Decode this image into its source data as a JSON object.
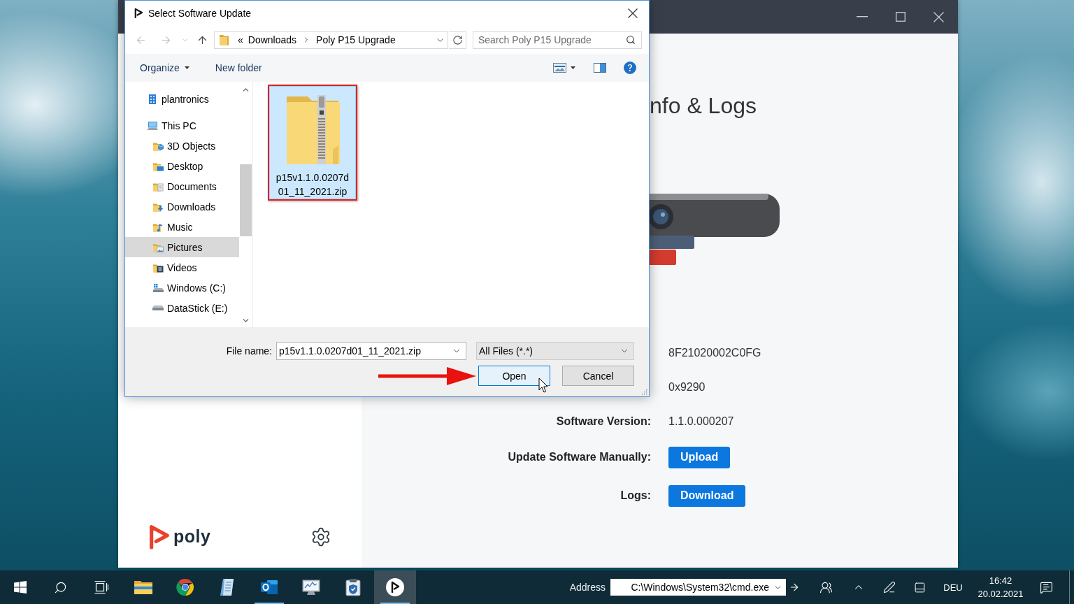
{
  "app_window": {
    "content": {
      "title": "nfo & Logs",
      "rows": [
        {
          "kind": "text",
          "value": "8F21020002C0FG"
        },
        {
          "kind": "text",
          "value": "0x9290"
        },
        {
          "kind": "text",
          "label": "Software Version:",
          "value": "1.1.0.000207"
        },
        {
          "kind": "button",
          "label": "Update Software Manually:",
          "value": "Upload"
        },
        {
          "kind": "button",
          "label": "Logs:",
          "value": "Download"
        }
      ]
    },
    "sidebar": {
      "logo_text": "poly"
    }
  },
  "dialog": {
    "title": "Select Software Update",
    "navigation": [
      {
        "kind": "back",
        "disabled": true
      },
      {
        "kind": "forward",
        "disabled": true
      },
      {
        "kind": "recent",
        "disabled": true
      },
      {
        "kind": "up",
        "disabled": false
      }
    ],
    "address": {
      "overflow": "«",
      "crumbs": [
        "Downloads",
        "Poly P15 Upgrade"
      ]
    },
    "search": {
      "placeholder": "Search Poly P15 Upgrade"
    },
    "toolbar": [
      {
        "kind": "menu",
        "label": "Organize"
      },
      {
        "kind": "button",
        "label": "New folder"
      }
    ],
    "nav_pane": [
      {
        "kind": "user",
        "label": "plantronics",
        "selected": false
      },
      {
        "kind": "computer",
        "label": "This PC",
        "selected": false,
        "children": [
          {
            "kind": "objects3d",
            "label": "3D Objects",
            "selected": false
          },
          {
            "kind": "desktop",
            "label": "Desktop",
            "selected": false
          },
          {
            "kind": "documents",
            "label": "Documents",
            "selected": false
          },
          {
            "kind": "downloads",
            "label": "Downloads",
            "selected": false
          },
          {
            "kind": "music",
            "label": "Music",
            "selected": false
          },
          {
            "kind": "pictures",
            "label": "Pictures",
            "selected": true
          },
          {
            "kind": "videos",
            "label": "Videos",
            "selected": false
          },
          {
            "kind": "system_drive",
            "label": "Windows (C:)",
            "selected": false
          },
          {
            "kind": "drive",
            "label": "DataStick (E:)",
            "selected": false
          }
        ]
      }
    ],
    "files": [
      {
        "kind": "zip",
        "name": "p15v1.1.0.0207d01_11_2021.zip",
        "selected": true,
        "annotated": true
      }
    ],
    "file_name": {
      "label": "File name:",
      "value": "p15v1.1.0.0207d01_11_2021.zip"
    },
    "filter": {
      "value": "All Files (*.*)"
    },
    "buttons": [
      {
        "label": "Open",
        "default": true,
        "annotated": true
      },
      {
        "label": "Cancel",
        "default": false,
        "annotated": false
      }
    ]
  },
  "taskbar": {
    "apps": [
      {
        "kind": "explorer",
        "running": false,
        "selected": false
      },
      {
        "kind": "browser",
        "running": false,
        "selected": false
      },
      {
        "kind": "document",
        "running": false,
        "selected": false
      },
      {
        "kind": "mail",
        "running": true,
        "selected": false
      },
      {
        "kind": "monitor",
        "running": false,
        "selected": false
      },
      {
        "kind": "clipboard",
        "running": false,
        "selected": false
      },
      {
        "kind": "poly",
        "running": true,
        "selected": true
      }
    ],
    "address": {
      "label": "Address",
      "value": "C:\\Windows\\System32\\cmd.exe"
    },
    "language": "DEU",
    "time": "16:42",
    "date": "20.02.2021"
  }
}
